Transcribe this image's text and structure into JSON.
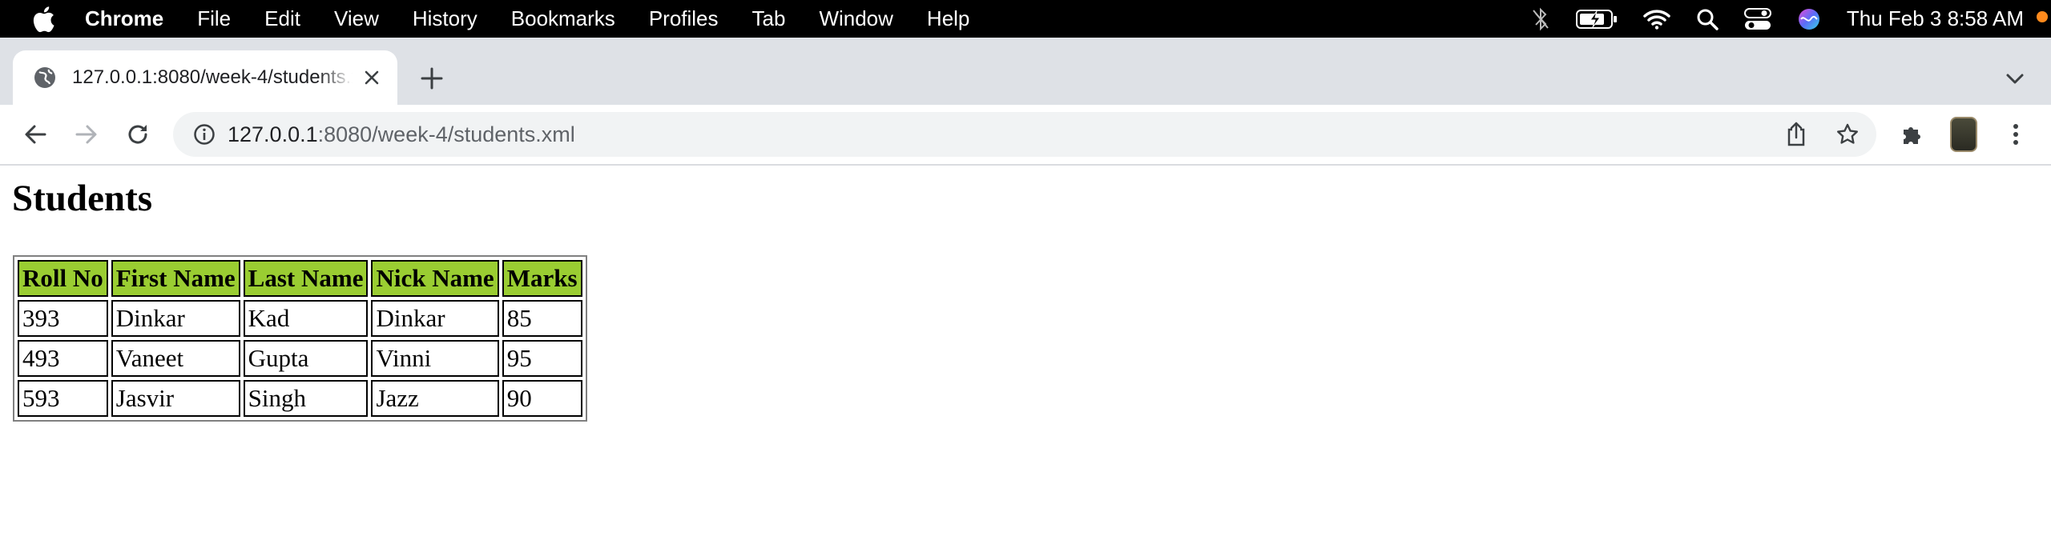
{
  "menubar": {
    "app_name": "Chrome",
    "items": [
      "File",
      "Edit",
      "View",
      "History",
      "Bookmarks",
      "Profiles",
      "Tab",
      "Window",
      "Help"
    ],
    "clock": "Thu Feb 3  8:58 AM"
  },
  "tab": {
    "title": "127.0.0.1:8080/week-4/students.xml"
  },
  "omnibox": {
    "host": "127.0.0.1",
    "path": ":8080/week-4/students.xml"
  },
  "page": {
    "heading": "Students",
    "table": {
      "headers": [
        "Roll No",
        "First Name",
        "Last Name",
        "Nick Name",
        "Marks"
      ],
      "rows": [
        [
          "393",
          "Dinkar",
          "Kad",
          "Dinkar",
          "85"
        ],
        [
          "493",
          "Vaneet",
          "Gupta",
          "Vinni",
          "95"
        ],
        [
          "593",
          "Jasvir",
          "Singh",
          "Jazz",
          "90"
        ]
      ]
    }
  },
  "colors": {
    "header_fill": "#9acd32",
    "menubar_bg": "#000000",
    "tabstrip_bg": "#dee1e6",
    "omnibox_bg": "#f1f3f4",
    "notification_dot": "#ff8a1c"
  },
  "icons": {
    "menubar": [
      "apple-icon",
      "bluetooth-off-icon",
      "battery-charging-icon",
      "wifi-icon",
      "spotlight-search-icon",
      "control-center-icon",
      "siri-icon"
    ],
    "tab": [
      "globe-icon",
      "close-icon",
      "new-tab-plus-icon",
      "tab-search-chevron-icon"
    ],
    "toolbar": [
      "back-arrow-icon",
      "forward-arrow-icon",
      "reload-icon",
      "site-info-icon",
      "share-icon",
      "bookmark-star-icon",
      "extensions-puzzle-icon",
      "profile-avatar",
      "more-menu-icon"
    ]
  }
}
